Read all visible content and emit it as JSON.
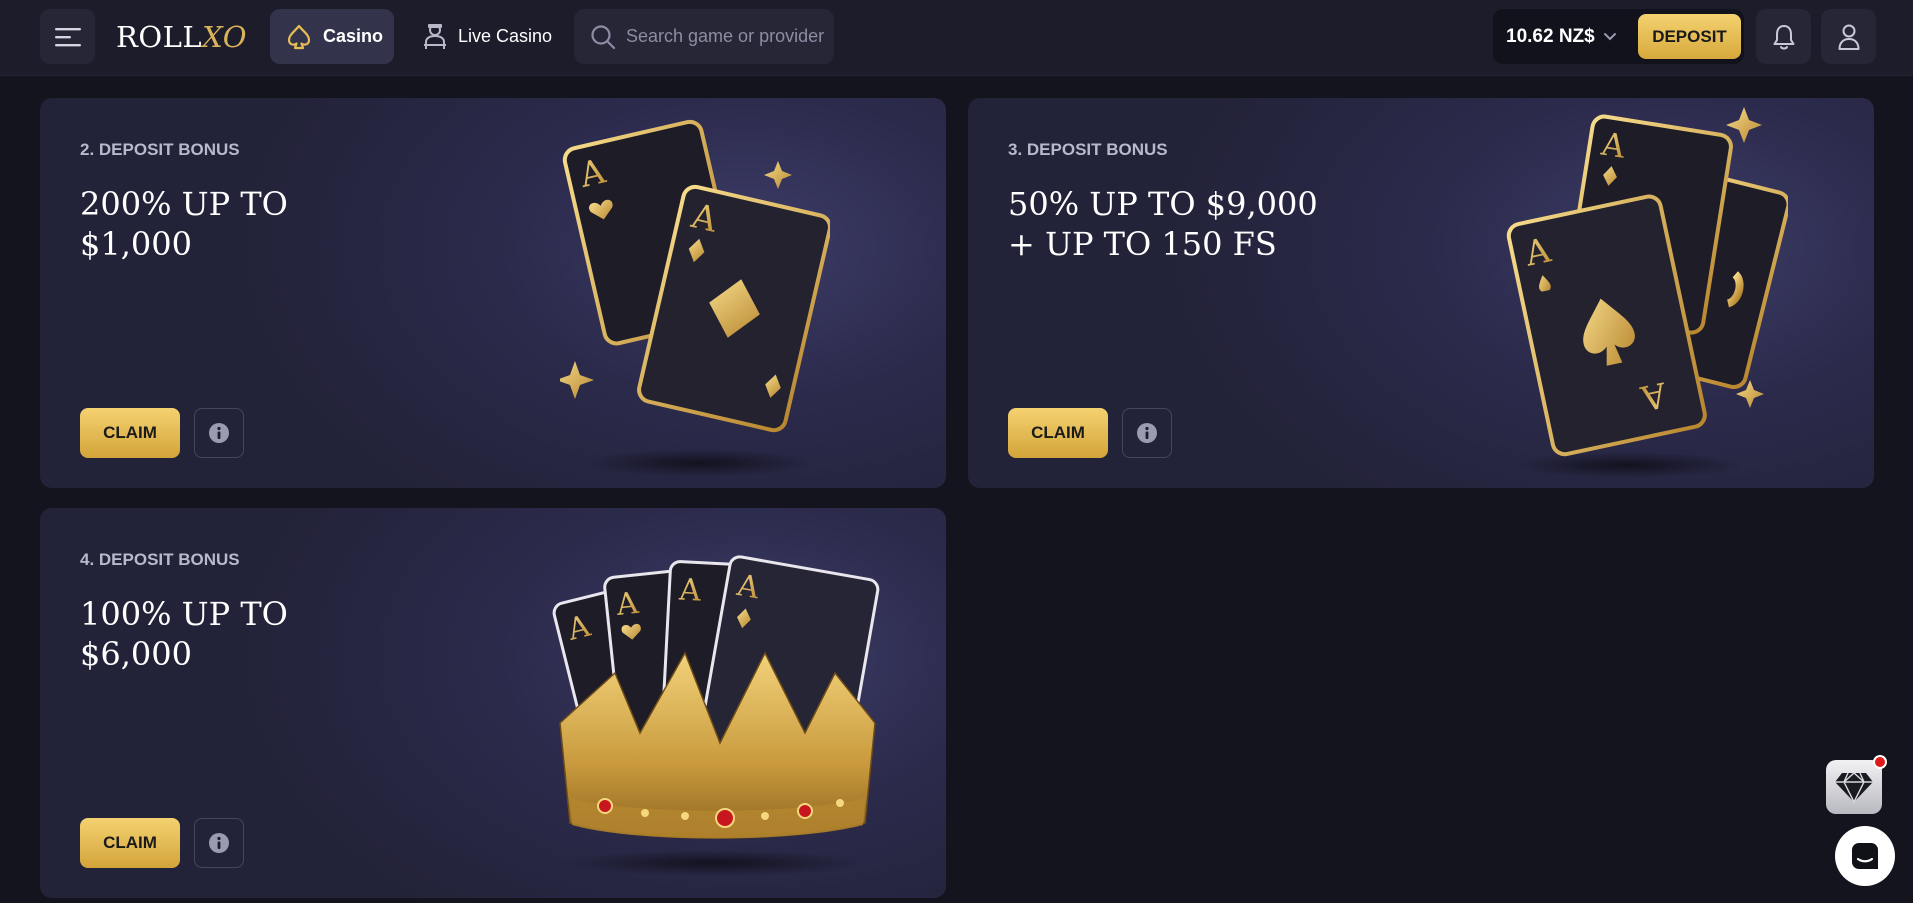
{
  "header": {
    "logo_text": "ROLL",
    "logo_accent": "XO",
    "nav": [
      {
        "label": "Casino",
        "icon": "spade-icon",
        "active": true
      },
      {
        "label": "Live Casino",
        "icon": "dealer-icon",
        "active": false
      }
    ],
    "search_placeholder": "Search game or provider",
    "balance": "10.62 NZ$",
    "deposit_label": "DEPOSIT"
  },
  "bonuses": [
    {
      "label": "2. DEPOSIT BONUS",
      "title_line1": "200% UP TO",
      "title_line2": "$1,000",
      "claim_label": "CLAIM",
      "art": "two-cards-art"
    },
    {
      "label": "3. DEPOSIT BONUS",
      "title_line1": "50% UP TO $9,000",
      "title_line2": "+ UP TO 150 FS",
      "claim_label": "CLAIM",
      "art": "three-cards-art"
    },
    {
      "label": "4. DEPOSIT BONUS",
      "title_line1": "100% UP TO",
      "title_line2": "$6,000",
      "claim_label": "CLAIM",
      "art": "crown-cards-art"
    }
  ],
  "colors": {
    "accent_gold": "#e6bd52",
    "background": "#14141f",
    "header": "#1c1c2b",
    "card": "#2b2a4b",
    "notification_dot": "#e01a1a"
  }
}
